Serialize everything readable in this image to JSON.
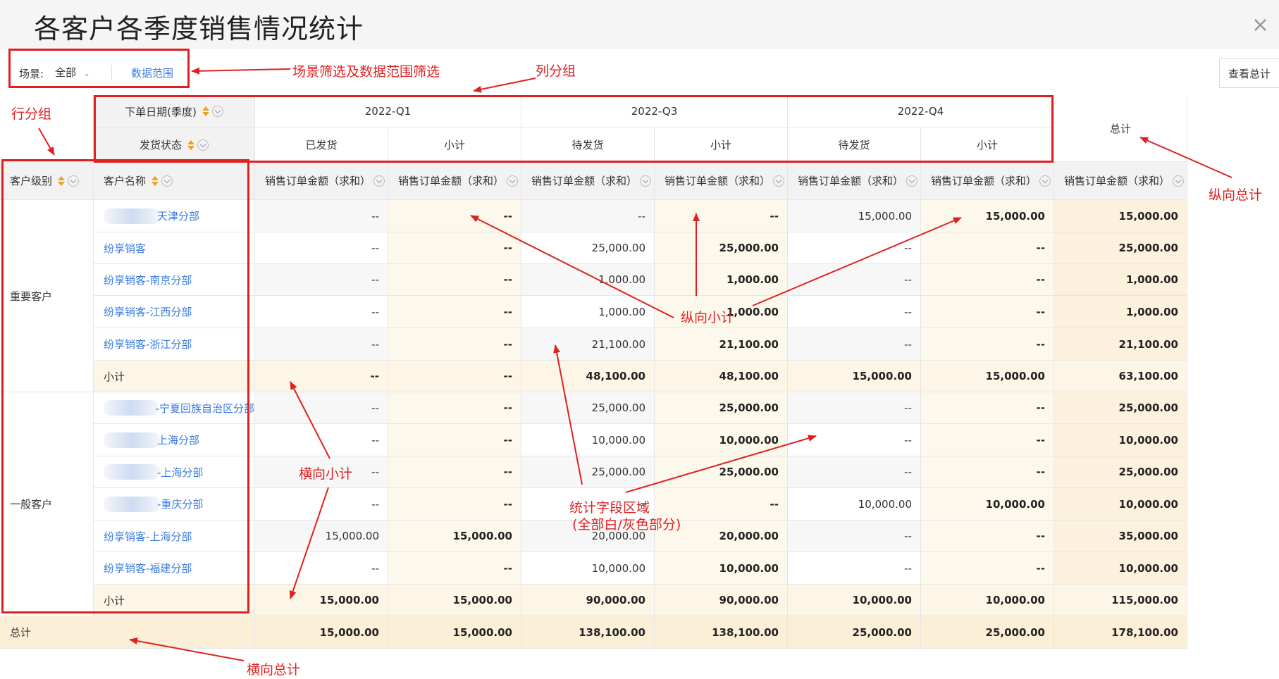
{
  "title": "各客户各季度销售情况统计",
  "close_glyph": "×",
  "toolbar": {
    "scene_label": "场景:",
    "scene_value": "全部",
    "data_range": "数据范围",
    "view_total": "查看总计"
  },
  "col_group_headers": {
    "order_date_label": "下单日期(季度)",
    "ship_status_label": "发货状态",
    "quarters": [
      "2022-Q1",
      "2022-Q3",
      "2022-Q4"
    ],
    "statuses": [
      "已发货",
      "小计",
      "待发货",
      "小计",
      "待发货",
      "小计"
    ],
    "total_label": "总计"
  },
  "row_headers": {
    "level_label": "客户级别",
    "name_label": "客户名称",
    "metric_label": "销售订单金额（求和）"
  },
  "groups": [
    {
      "level": "重要客户",
      "rows": [
        {
          "name": "天津分部",
          "values": [
            "--",
            "--",
            "--",
            "--",
            "15,000.00",
            "15,000.00",
            "15,000.00"
          ]
        },
        {
          "name": "纷享销客",
          "values": [
            "--",
            "--",
            "25,000.00",
            "25,000.00",
            "--",
            "--",
            "25,000.00"
          ]
        },
        {
          "name": "纷享销客-南京分部",
          "values": [
            "--",
            "--",
            "1,000.00",
            "1,000.00",
            "--",
            "--",
            "1,000.00"
          ]
        },
        {
          "name": "纷享销客-江西分部",
          "values": [
            "--",
            "--",
            "1,000.00",
            "1,000.00",
            "--",
            "--",
            "1,000.00"
          ]
        },
        {
          "name": "纷享销客-浙江分部",
          "values": [
            "--",
            "--",
            "21,100.00",
            "21,100.00",
            "--",
            "--",
            "21,100.00"
          ]
        }
      ],
      "subtotal": {
        "name": "小计",
        "values": [
          "--",
          "--",
          "48,100.00",
          "48,100.00",
          "15,000.00",
          "15,000.00",
          "63,100.00"
        ]
      }
    },
    {
      "level": "一般客户",
      "rows": [
        {
          "name": "-宁夏回族自治区分部",
          "values": [
            "--",
            "--",
            "25,000.00",
            "25,000.00",
            "--",
            "--",
            "25,000.00"
          ]
        },
        {
          "name": "上海分部",
          "values": [
            "--",
            "--",
            "10,000.00",
            "10,000.00",
            "--",
            "--",
            "10,000.00"
          ]
        },
        {
          "name": "-上海分部",
          "values": [
            "--",
            "--",
            "25,000.00",
            "25,000.00",
            "--",
            "--",
            "25,000.00"
          ]
        },
        {
          "name": "-重庆分部",
          "values": [
            "--",
            "--",
            "--",
            "--",
            "10,000.00",
            "10,000.00",
            "10,000.00"
          ]
        },
        {
          "name": "纷享销客-上海分部",
          "values": [
            "15,000.00",
            "15,000.00",
            "20,000.00",
            "20,000.00",
            "--",
            "--",
            "35,000.00"
          ]
        },
        {
          "name": "纷享销客-福建分部",
          "values": [
            "--",
            "--",
            "10,000.00",
            "10,000.00",
            "--",
            "--",
            "10,000.00"
          ]
        }
      ],
      "subtotal": {
        "name": "小计",
        "values": [
          "15,000.00",
          "15,000.00",
          "90,000.00",
          "90,000.00",
          "10,000.00",
          "10,000.00",
          "115,000.00"
        ]
      }
    }
  ],
  "grand_total": {
    "name": "总计",
    "values": [
      "15,000.00",
      "15,000.00",
      "138,100.00",
      "138,100.00",
      "25,000.00",
      "25,000.00",
      "178,100.00"
    ]
  },
  "annotations": {
    "scene_filter": "场景筛选及数据范围筛选",
    "col_group": "列分组",
    "row_group": "行分组",
    "v_total": "纵向总计",
    "v_subtotal": "纵向小计",
    "h_subtotal": "横向小计",
    "stats_area_1": "统计字段区域",
    "stats_area_2": "(全部白/灰色部分)",
    "h_total": "横向总计"
  },
  "colors": {
    "annotation_red": "#e02020",
    "link_blue": "#3a7be0",
    "sort_orange": "#f0a020"
  }
}
